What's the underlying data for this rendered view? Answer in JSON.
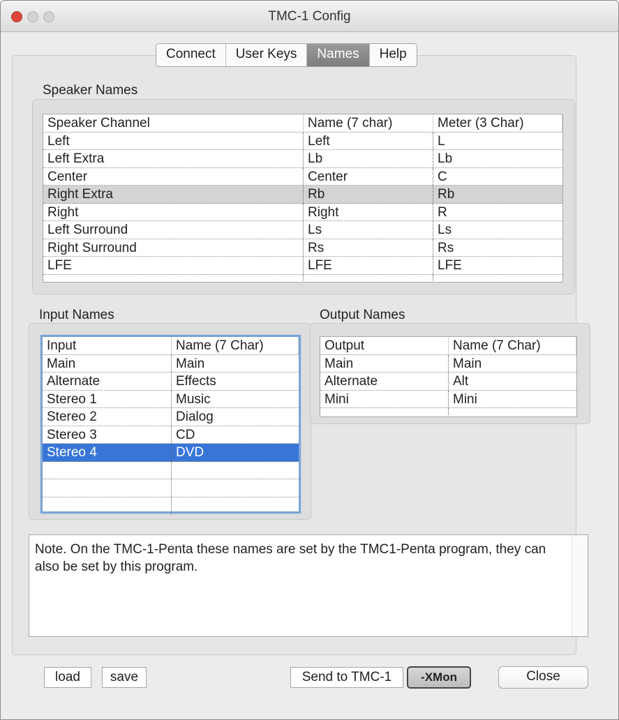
{
  "window": {
    "title": "TMC-1 Config"
  },
  "tabs": [
    {
      "label": "Connect"
    },
    {
      "label": "User Keys"
    },
    {
      "label": "Names"
    },
    {
      "label": "Help"
    }
  ],
  "active_tab": "Names",
  "speaker_names": {
    "label": "Speaker Names",
    "columns": [
      "Speaker Channel",
      "Name (7 char)",
      "Meter (3 Char)"
    ],
    "rows": [
      [
        "Left",
        "Left",
        "L"
      ],
      [
        "Left Extra",
        "Lb",
        "Lb"
      ],
      [
        "Center",
        "Center",
        "C"
      ],
      [
        "Right Extra",
        "Rb",
        "Rb"
      ],
      [
        "Right",
        "Right",
        "R"
      ],
      [
        "Left Surround",
        "Ls",
        "Ls"
      ],
      [
        "Right Surround",
        "Rs",
        "Rs"
      ],
      [
        "LFE",
        "LFE",
        "LFE"
      ]
    ]
  },
  "input_names": {
    "label": "Input Names",
    "columns": [
      "Input",
      "Name (7 Char)"
    ],
    "rows": [
      [
        "Main",
        "Main"
      ],
      [
        "Alternate",
        "Effects"
      ],
      [
        "Stereo 1",
        "Music"
      ],
      [
        "Stereo 2",
        "Dialog"
      ],
      [
        "Stereo 3",
        "CD"
      ],
      [
        "Stereo 4",
        "DVD"
      ]
    ]
  },
  "output_names": {
    "label": "Output Names",
    "columns": [
      "Output",
      "Name (7 Char)"
    ],
    "rows": [
      [
        "Main",
        "Main"
      ],
      [
        "Alternate",
        "Alt"
      ],
      [
        "Mini",
        "Mini"
      ]
    ]
  },
  "note": "Note. On the TMC-1-Penta these names are set by the TMC1-Penta program, they can also be set by this program.",
  "buttons": {
    "load": "load",
    "save": "save",
    "send": "Send to TMC-1",
    "xmon": "-XMon",
    "close": "Close"
  }
}
